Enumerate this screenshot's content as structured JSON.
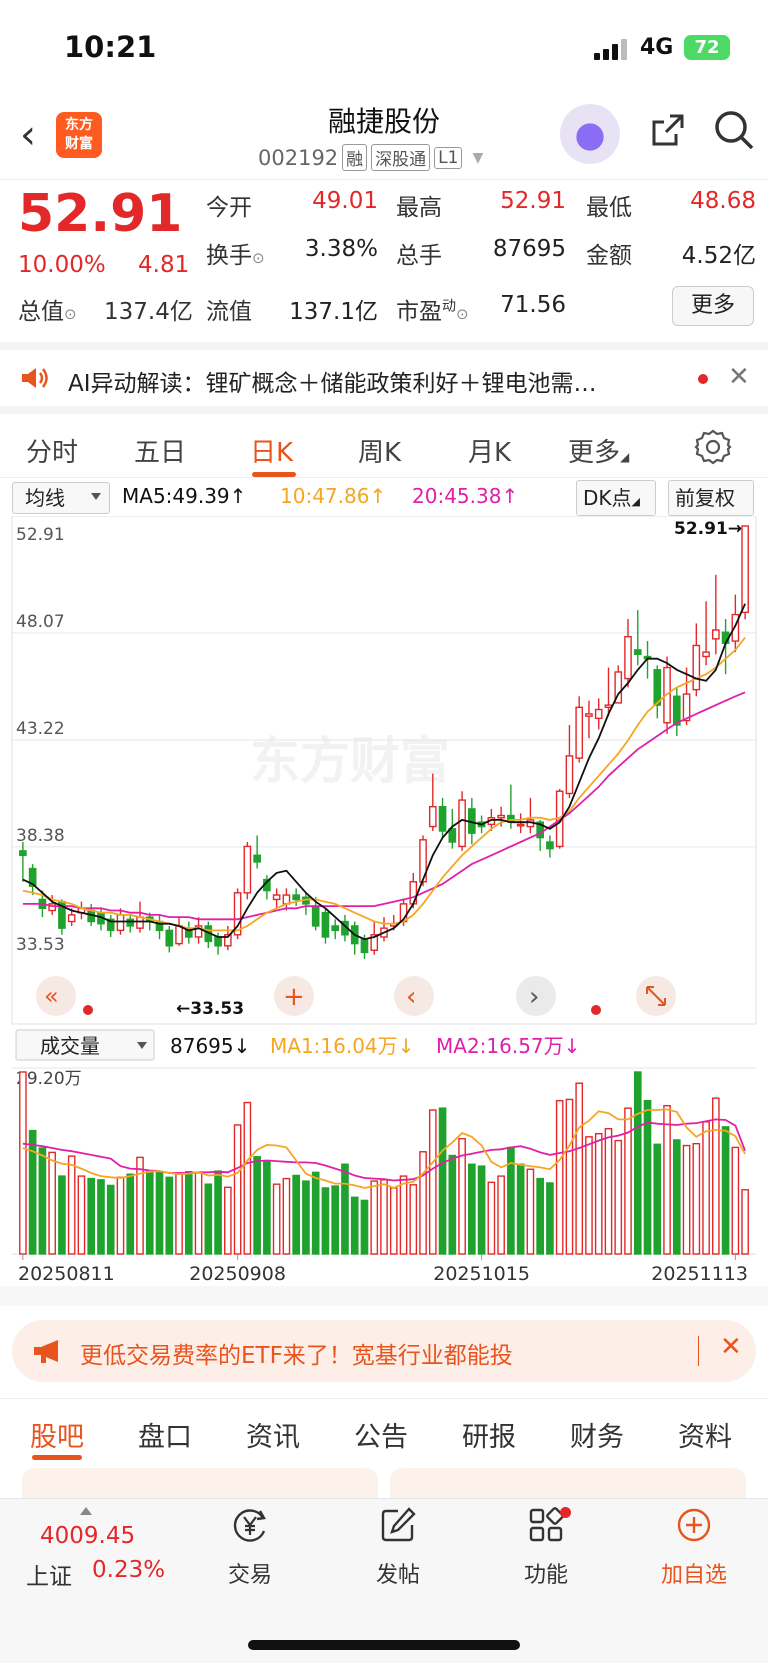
{
  "status": {
    "time": "10:21",
    "network": "4G",
    "battery": "72"
  },
  "header": {
    "logo_line1": "东方",
    "logo_line2": "财富",
    "name": "融捷股份",
    "code": "002192",
    "tags": [
      "融",
      "深股通",
      "L1"
    ]
  },
  "quote": {
    "price": "52.91",
    "change_pct": "10.00%",
    "change": "4.81",
    "rows": [
      [
        [
          "今开",
          "49.01"
        ],
        [
          "最高",
          "52.91"
        ],
        [
          "最低",
          "48.68"
        ]
      ],
      [
        [
          "换手",
          "3.38%"
        ],
        [
          "总手",
          "87695"
        ],
        [
          "金额",
          "4.52亿"
        ]
      ],
      [
        [
          "总值",
          "137.4亿"
        ],
        [
          "流值",
          "137.1亿"
        ],
        [
          "市盈",
          "71.56"
        ]
      ]
    ],
    "pe_superscript": "动",
    "more": "更多"
  },
  "ai_banner": {
    "text": "AI异动解读：锂矿概念＋储能政策利好＋锂电池需…"
  },
  "period_tabs": [
    "分时",
    "五日",
    "日K",
    "周K",
    "月K",
    "更多"
  ],
  "ma_row": {
    "selector": "均线",
    "ma5": "MA5:49.39↑",
    "ma10": "10:47.86↑",
    "ma20": "20:45.38↑",
    "dk": "DK点",
    "adjust": "前复权"
  },
  "kline": {
    "y_labels": [
      "52.91",
      "48.07",
      "43.22",
      "38.38",
      "33.53"
    ],
    "max_label": "52.91→",
    "min_label": "←33.53",
    "watermark": "东方财富"
  },
  "vol_row": {
    "selector": "成交量",
    "vol": "87695↓",
    "ma1": "MA1:16.04万↓",
    "ma2": "MA2:16.57万↓",
    "ymax": "29.20万"
  },
  "dates": [
    "20250811",
    "20250908",
    "20251015",
    "20251113"
  ],
  "colors": {
    "up": "#e22828",
    "down": "#1fa22e",
    "ma5": "#111111",
    "ma10": "#f5a623",
    "ma20": "#e020a8",
    "accent": "#e8541e"
  },
  "chart_data": {
    "type": "candlestick",
    "ylim": [
      33.53,
      52.91
    ],
    "candles": [
      [
        38.2,
        38.0,
        38.6,
        36.8
      ],
      [
        37.4,
        36.6,
        37.6,
        36.2
      ],
      [
        36.0,
        35.6,
        36.4,
        35.2
      ],
      [
        35.5,
        35.8,
        36.2,
        35.3
      ],
      [
        35.9,
        34.7,
        36.0,
        34.4
      ],
      [
        35.0,
        35.3,
        35.6,
        34.8
      ],
      [
        35.4,
        35.6,
        35.9,
        35.1
      ],
      [
        35.5,
        35.0,
        35.8,
        34.8
      ],
      [
        35.4,
        34.9,
        35.6,
        34.6
      ],
      [
        35.1,
        34.6,
        35.3,
        34.3
      ],
      [
        34.6,
        35.3,
        35.6,
        34.4
      ],
      [
        35.1,
        34.8,
        35.3,
        34.5
      ],
      [
        34.7,
        35.2,
        35.9,
        34.5
      ],
      [
        35.2,
        35.0,
        35.4,
        34.6
      ],
      [
        35.0,
        34.6,
        35.3,
        34.2
      ],
      [
        34.6,
        33.9,
        34.8,
        33.6
      ],
      [
        34.0,
        34.8,
        35.2,
        33.9
      ],
      [
        34.7,
        34.3,
        35.0,
        34.0
      ],
      [
        34.3,
        34.8,
        35.2,
        34.0
      ],
      [
        34.8,
        34.1,
        35.0,
        33.8
      ],
      [
        34.3,
        33.9,
        34.5,
        33.5
      ],
      [
        33.9,
        34.4,
        34.8,
        33.7
      ],
      [
        34.4,
        36.3,
        36.5,
        34.2
      ],
      [
        36.3,
        38.4,
        38.6,
        36.0
      ],
      [
        38.0,
        37.7,
        38.9,
        37.4
      ],
      [
        36.9,
        36.4,
        37.1,
        36.0
      ],
      [
        36.0,
        36.2,
        36.5,
        35.6
      ],
      [
        35.8,
        36.2,
        36.5,
        35.5
      ],
      [
        36.2,
        36.0,
        36.5,
        35.7
      ],
      [
        36.1,
        35.8,
        36.3,
        35.3
      ],
      [
        35.7,
        34.8,
        36.1,
        34.6
      ],
      [
        35.4,
        34.3,
        35.6,
        34.0
      ],
      [
        34.8,
        34.6,
        35.1,
        34.2
      ],
      [
        35.0,
        34.4,
        35.3,
        34.1
      ],
      [
        34.8,
        34.0,
        35.0,
        33.5
      ],
      [
        34.2,
        33.6,
        34.4,
        33.3
      ],
      [
        33.7,
        34.4,
        35.0,
        33.5
      ],
      [
        34.3,
        34.7,
        35.2,
        34.1
      ],
      [
        34.8,
        34.9,
        35.3,
        34.6
      ],
      [
        35.0,
        35.8,
        36.0,
        34.8
      ],
      [
        35.8,
        36.8,
        37.2,
        35.6
      ],
      [
        36.8,
        38.7,
        38.9,
        36.6
      ],
      [
        39.3,
        40.2,
        41.7,
        39.1
      ],
      [
        40.2,
        39.1,
        40.6,
        38.8
      ],
      [
        39.2,
        38.6,
        40.1,
        38.3
      ],
      [
        38.4,
        40.5,
        40.9,
        38.2
      ],
      [
        40.1,
        39.0,
        40.6,
        38.5
      ],
      [
        39.5,
        39.3,
        39.8,
        39.0
      ],
      [
        39.4,
        39.7,
        40.1,
        39.1
      ],
      [
        39.7,
        39.8,
        40.2,
        39.3
      ],
      [
        39.8,
        39.5,
        41.2,
        39.2
      ],
      [
        39.4,
        39.4,
        39.9,
        39.0
      ],
      [
        39.3,
        39.6,
        40.6,
        39.0
      ],
      [
        39.5,
        38.8,
        39.6,
        38.2
      ],
      [
        38.6,
        38.3,
        38.9,
        37.9
      ],
      [
        38.4,
        40.9,
        41.0,
        38.3
      ],
      [
        40.8,
        42.5,
        43.9,
        40.6
      ],
      [
        42.4,
        44.7,
        45.2,
        42.2
      ],
      [
        44.3,
        44.4,
        45.0,
        43.3
      ],
      [
        44.2,
        44.6,
        45.1,
        43.7
      ],
      [
        44.7,
        44.8,
        46.5,
        44.3
      ],
      [
        44.9,
        46.3,
        46.6,
        44.9
      ],
      [
        46.0,
        47.9,
        48.7,
        45.6
      ],
      [
        47.3,
        47.1,
        49.1,
        46.6
      ],
      [
        47.0,
        46.9,
        47.7,
        46.0
      ],
      [
        46.4,
        44.8,
        46.6,
        44.2
      ],
      [
        44.0,
        46.5,
        47.0,
        43.5
      ],
      [
        45.2,
        43.9,
        45.6,
        43.4
      ],
      [
        44.1,
        45.3,
        46.5,
        43.9
      ],
      [
        45.5,
        47.5,
        48.5,
        45.2
      ],
      [
        47.0,
        47.2,
        49.5,
        46.6
      ],
      [
        47.8,
        48.2,
        50.7,
        47.1
      ],
      [
        48.1,
        47.6,
        48.7,
        46.2
      ],
      [
        47.7,
        48.9,
        49.8,
        47.2
      ],
      [
        49.0,
        52.91,
        52.91,
        48.68
      ]
    ],
    "ma5": [
      36.9,
      36.7,
      36.3,
      35.9,
      35.7,
      35.5,
      35.4,
      35.3,
      35.2,
      35.0,
      35.0,
      35.0,
      35.0,
      35.0,
      34.9,
      34.9,
      34.8,
      34.6,
      34.7,
      34.5,
      34.3,
      34.3,
      34.8,
      35.6,
      36.3,
      36.8,
      37.2,
      37.3,
      36.8,
      36.3,
      35.9,
      35.6,
      35.2,
      34.8,
      34.4,
      34.2,
      34.3,
      34.5,
      34.7,
      35.1,
      35.8,
      36.9,
      38.0,
      38.8,
      39.3,
      39.6,
      39.5,
      39.4,
      39.6,
      39.6,
      39.5,
      39.5,
      39.5,
      39.4,
      39.2,
      39.5,
      40.2,
      41.3,
      42.4,
      43.3,
      44.4,
      45.3,
      45.8,
      46.4,
      46.9,
      46.9,
      46.7,
      46.4,
      46.2,
      46.0,
      45.9,
      46.4,
      47.6,
      48.4,
      49.39
    ],
    "ma10": [
      36.4,
      36.3,
      36.2,
      36.0,
      35.9,
      35.8,
      35.6,
      35.5,
      35.4,
      35.4,
      35.3,
      35.3,
      35.2,
      35.1,
      35.0,
      34.9,
      34.8,
      34.7,
      34.7,
      34.6,
      34.6,
      34.6,
      34.6,
      34.8,
      35.1,
      35.4,
      35.6,
      35.8,
      35.9,
      36.0,
      36.0,
      35.9,
      35.8,
      35.6,
      35.4,
      35.2,
      35.0,
      34.9,
      34.9,
      35.0,
      35.3,
      35.8,
      36.4,
      37.0,
      37.5,
      38.0,
      38.4,
      38.8,
      39.2,
      39.5,
      39.6,
      39.6,
      39.7,
      39.7,
      39.6,
      39.7,
      40.0,
      40.6,
      41.1,
      41.6,
      42.1,
      42.6,
      43.2,
      43.9,
      44.5,
      44.9,
      45.3,
      45.6,
      45.8,
      46.0,
      46.2,
      46.5,
      46.9,
      47.3,
      47.86
    ],
    "ma20": [
      35.8,
      35.8,
      35.8,
      35.7,
      35.7,
      35.7,
      35.6,
      35.6,
      35.6,
      35.5,
      35.5,
      35.4,
      35.4,
      35.3,
      35.3,
      35.2,
      35.2,
      35.2,
      35.1,
      35.1,
      35.1,
      35.1,
      35.1,
      35.2,
      35.3,
      35.4,
      35.5,
      35.6,
      35.6,
      35.7,
      35.7,
      35.7,
      35.7,
      35.7,
      35.7,
      35.7,
      35.7,
      35.8,
      35.9,
      36.0,
      36.1,
      36.3,
      36.5,
      36.7,
      37.0,
      37.3,
      37.6,
      37.8,
      38.0,
      38.2,
      38.4,
      38.6,
      38.8,
      39.0,
      39.3,
      39.6,
      39.9,
      40.3,
      40.7,
      41.1,
      41.6,
      42.0,
      42.4,
      42.8,
      43.1,
      43.4,
      43.7,
      44.0,
      44.2,
      44.4,
      44.6,
      44.8,
      45.0,
      45.2,
      45.38
    ],
    "volume": [
      29.2,
      19.8,
      17.0,
      16.3,
      12.5,
      15.7,
      12.5,
      12.1,
      11.9,
      11.0,
      12.3,
      12.8,
      15.5,
      13.3,
      13.1,
      12.3,
      13.0,
      13.2,
      13.0,
      11.2,
      13.3,
      10.7,
      20.7,
      24.3,
      15.6,
      14.9,
      11.2,
      12.1,
      12.6,
      11.7,
      13.1,
      10.6,
      10.9,
      14.4,
      9.1,
      8.6,
      11.7,
      11.9,
      10.6,
      12.5,
      11.1,
      16.4,
      23.1,
      23.4,
      15.8,
      18.5,
      14.4,
      14.1,
      11.5,
      12.5,
      17.1,
      14.4,
      13.6,
      12.1,
      11.4,
      24.6,
      24.8,
      27.4,
      18.8,
      19.3,
      20.1,
      18.2,
      23.4,
      29.2,
      24.6,
      17.6,
      23.8,
      18.3,
      17.4,
      17.7,
      21.2,
      25.0,
      20.4,
      17.1,
      10.3
    ],
    "vol_up": [
      1,
      0,
      0,
      1,
      0,
      1,
      1,
      0,
      0,
      0,
      1,
      0,
      1,
      0,
      0,
      0,
      1,
      0,
      1,
      0,
      0,
      1,
      1,
      1,
      0,
      0,
      1,
      1,
      0,
      0,
      0,
      0,
      0,
      0,
      0,
      0,
      1,
      1,
      1,
      1,
      1,
      1,
      1,
      0,
      0,
      1,
      0,
      0,
      1,
      1,
      0,
      0,
      1,
      0,
      0,
      1,
      1,
      1,
      1,
      1,
      1,
      1,
      1,
      0,
      0,
      0,
      1,
      0,
      1,
      1,
      1,
      1,
      0,
      1,
      1
    ],
    "vol_ma1": [
      17.0,
      16.5,
      15.8,
      15.0,
      14.5,
      14.3,
      13.7,
      13.0,
      12.5,
      12.3,
      12.2,
      12.5,
      12.9,
      13.2,
      13.3,
      13.0,
      12.8,
      12.9,
      13.1,
      12.6,
      12.7,
      12.4,
      13.0,
      15.0,
      16.7,
      17.5,
      17.4,
      17.1,
      15.0,
      12.9,
      12.2,
      11.8,
      11.3,
      11.3,
      11.0,
      10.6,
      10.9,
      11.2,
      10.6,
      11.3,
      11.6,
      12.9,
      14.7,
      16.6,
      17.9,
      19.4,
      18.8,
      17.4,
      14.8,
      13.9,
      14.6,
      14.3,
      14.1,
      13.9,
      13.6,
      15.1,
      17.4,
      20.3,
      21.4,
      22.9,
      22.6,
      21.6,
      21.6,
      22.5,
      23.1,
      23.1,
      23.2,
      22.8,
      20.3,
      18.8,
      19.7,
      19.9,
      19.8,
      18.9,
      16.04
    ],
    "vol_ma2": [
      17.7,
      17.5,
      17.3,
      17.0,
      16.7,
      16.5,
      16.2,
      15.9,
      15.6,
      15.3,
      14.1,
      13.7,
      13.6,
      13.4,
      13.3,
      13.0,
      13.0,
      13.0,
      13.1,
      13.1,
      13.2,
      13.1,
      13.8,
      14.6,
      14.9,
      15.0,
      14.9,
      14.8,
      14.7,
      14.7,
      14.6,
      14.2,
      13.7,
      13.2,
      12.6,
      12.2,
      12.1,
      12.0,
      11.8,
      11.9,
      12.0,
      12.6,
      13.7,
      14.6,
      15.3,
      15.8,
      16.1,
      16.4,
      16.7,
      16.8,
      17.1,
      17.3,
      16.9,
      16.3,
      15.9,
      16.2,
      16.5,
      17.0,
      17.6,
      18.2,
      18.7,
      19.0,
      19.5,
      20.4,
      21.1,
      20.9,
      20.8,
      20.7,
      20.9,
      21.0,
      21.3,
      21.6,
      21.5,
      20.6,
      16.57
    ],
    "dates": [
      "20250811",
      "20250908",
      "20251015",
      "20251113"
    ]
  },
  "promo": {
    "text": "更低交易费率的ETF来了！宽基行业都能投"
  },
  "bottom_tabs": [
    "股吧",
    "盘口",
    "资讯",
    "公告",
    "研报",
    "财务",
    "资料"
  ],
  "index": {
    "value": "4009.45",
    "name": "上证",
    "pct": "0.23%"
  },
  "nav": [
    "交易",
    "发帖",
    "功能",
    "加自选"
  ]
}
